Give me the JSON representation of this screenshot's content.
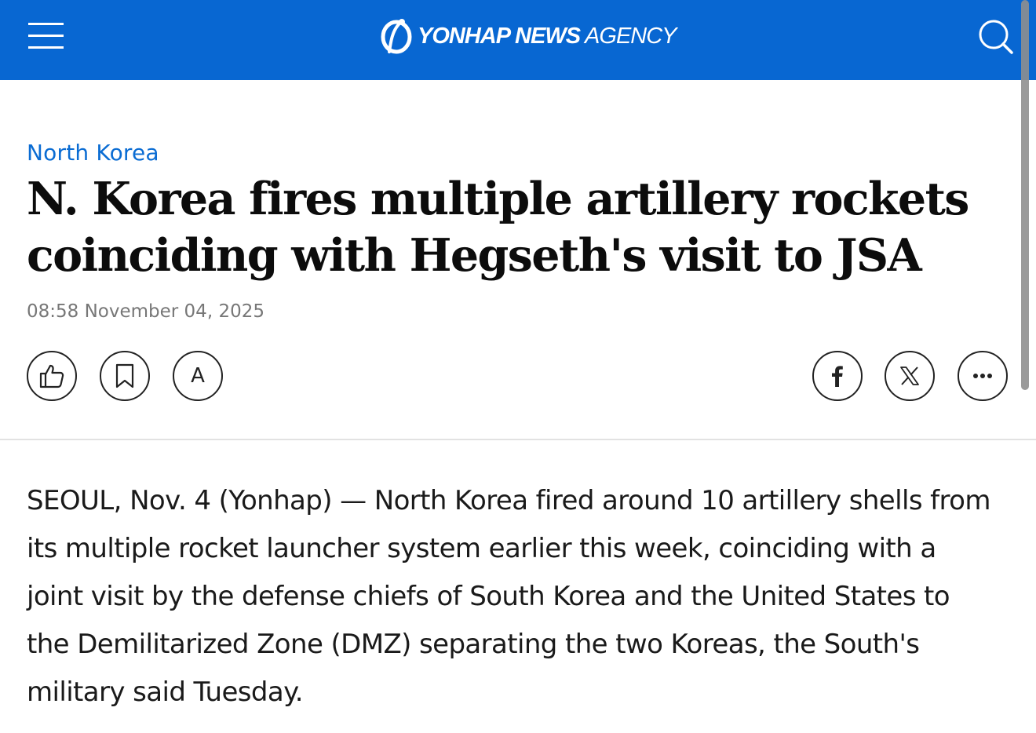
{
  "header": {
    "logo_bold": "YONHAP NEWS",
    "logo_light": " AGENCY",
    "brand_color": "#0867d2"
  },
  "icons": {
    "menu": "hamburger-icon",
    "search": "search-icon",
    "like": "thumbs-up-icon",
    "bookmark": "bookmark-icon",
    "facebook": "facebook-icon",
    "x": "x-twitter-icon",
    "more": "more-dots-icon"
  },
  "article": {
    "category": "North Korea",
    "headline": "N. Korea fires multiple artillery rockets coinciding with Hegseth's visit to JSA",
    "timestamp": "08:58 November 04, 2025",
    "body": "SEOUL, Nov. 4 (Yonhap) — North Korea fired around 10 artillery shells from its multiple rocket launcher system earlier this week, coinciding with a joint visit by the defense chiefs of South Korea and the United States to the Demilitarized Zone (DMZ) separating the two Koreas, the South's military said Tuesday."
  },
  "actions": {
    "font_size_label": "A"
  }
}
